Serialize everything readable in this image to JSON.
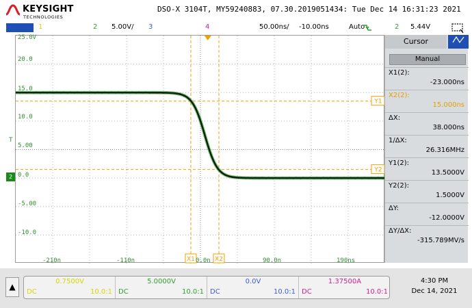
{
  "header": {
    "brand": "KEYSIGHT",
    "brand_sub": "TECHNOLOGIES",
    "title": "DSO-X 3104T, MY59240883, 07.30.2019051434: Tue Dec 14 16:31:23 2021"
  },
  "channel_bar": {
    "ch1_num": "1",
    "ch2_num": "2",
    "ch2_scale": "5.00V/",
    "ch3_num": "3",
    "ch4_num": "4",
    "timebase": "50.00ns/",
    "delay": "-10.00ns",
    "trigger_mode": "Auto",
    "trigger_source": "2",
    "trigger_level": "5.44V"
  },
  "plot": {
    "y_labels": [
      "25.0V",
      "20.0",
      "15.0",
      "10.0",
      "5.00",
      "0.0",
      "-5.00",
      "-10.0"
    ],
    "x_labels": [
      "-210n",
      "-110n",
      "0.0n",
      "90.0n",
      "190ns"
    ],
    "cursor_labels": {
      "x1": "X1",
      "x2": "X2",
      "y1": "Y1",
      "y2": "Y2"
    },
    "trigger_marker": "T",
    "ground_marker": "2"
  },
  "cursor_panel": {
    "tab_label": "Cursor",
    "mode_button": "Manual",
    "rows": [
      {
        "label": "X1(2):",
        "value": "-23.000ns"
      },
      {
        "label": "X2(2):",
        "value": "15.000ns"
      },
      {
        "label": "ΔX:",
        "value": "38.000ns"
      },
      {
        "label": "1/ΔX:",
        "value": "26.316MHz"
      },
      {
        "label": "Y1(2):",
        "value": "13.5000V"
      },
      {
        "label": "Y2(2):",
        "value": "1.5000V"
      },
      {
        "label": "ΔY:",
        "value": "-12.0000V"
      },
      {
        "label": "ΔY/ΔX:",
        "value": "-315.789MV/s"
      }
    ]
  },
  "channels": [
    {
      "scale": "0.7500V",
      "coupling": "DC",
      "probe": "10.0:1",
      "color": "#d6d600"
    },
    {
      "scale": "5.0000V",
      "coupling": "DC",
      "probe": "10.0:1",
      "color": "#33bb33"
    },
    {
      "scale": "0.0V",
      "coupling": "DC",
      "probe": "10.0:1",
      "color": "#3366dd"
    },
    {
      "scale": "1.37500A",
      "coupling": "DC",
      "probe": "10.0:1",
      "color": "#cc2288"
    }
  ],
  "clock": {
    "time": "4:30 PM",
    "date": "Dec 14, 2021"
  },
  "colors": {
    "ch1": "#e0e000",
    "ch2": "#2f9f2f",
    "ch3": "#3b5bd6",
    "ch4": "#d0208a",
    "cursor": "#f0a000",
    "trace": "#0d2a0d"
  }
}
